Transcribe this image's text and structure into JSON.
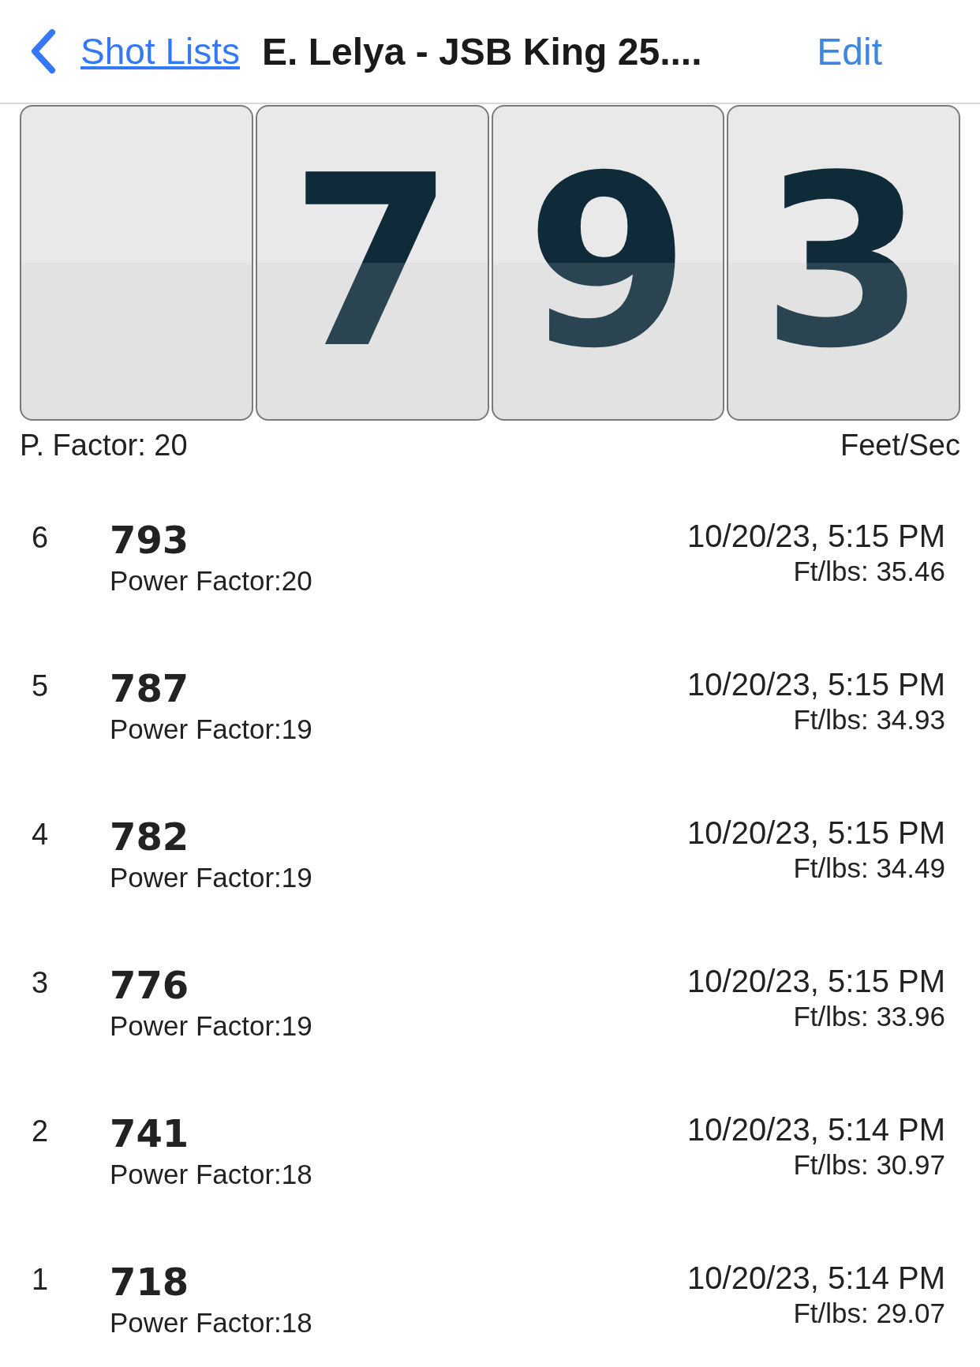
{
  "nav": {
    "back_label": "Shot Lists",
    "title": "E. Lelya - JSB King 25....",
    "action": "Edit"
  },
  "display": {
    "digits": [
      "7",
      "9",
      "3"
    ],
    "left_label": "P. Factor: 20",
    "right_label": "Feet/Sec"
  },
  "shots": [
    {
      "index": "6",
      "velocity": "793",
      "power_factor": "Power Factor:20",
      "time": "10/20/23, 5:15 PM",
      "energy": "Ft/lbs: 35.46"
    },
    {
      "index": "5",
      "velocity": "787",
      "power_factor": "Power Factor:19",
      "time": "10/20/23, 5:15 PM",
      "energy": "Ft/lbs: 34.93"
    },
    {
      "index": "4",
      "velocity": "782",
      "power_factor": "Power Factor:19",
      "time": "10/20/23, 5:15 PM",
      "energy": "Ft/lbs: 34.49"
    },
    {
      "index": "3",
      "velocity": "776",
      "power_factor": "Power Factor:19",
      "time": "10/20/23, 5:15 PM",
      "energy": "Ft/lbs: 33.96"
    },
    {
      "index": "2",
      "velocity": "741",
      "power_factor": "Power Factor:18",
      "time": "10/20/23, 5:14 PM",
      "energy": "Ft/lbs: 30.97"
    },
    {
      "index": "1",
      "velocity": "718",
      "power_factor": "Power Factor:18",
      "time": "10/20/23, 5:14 PM",
      "energy": "Ft/lbs: 29.07"
    }
  ]
}
